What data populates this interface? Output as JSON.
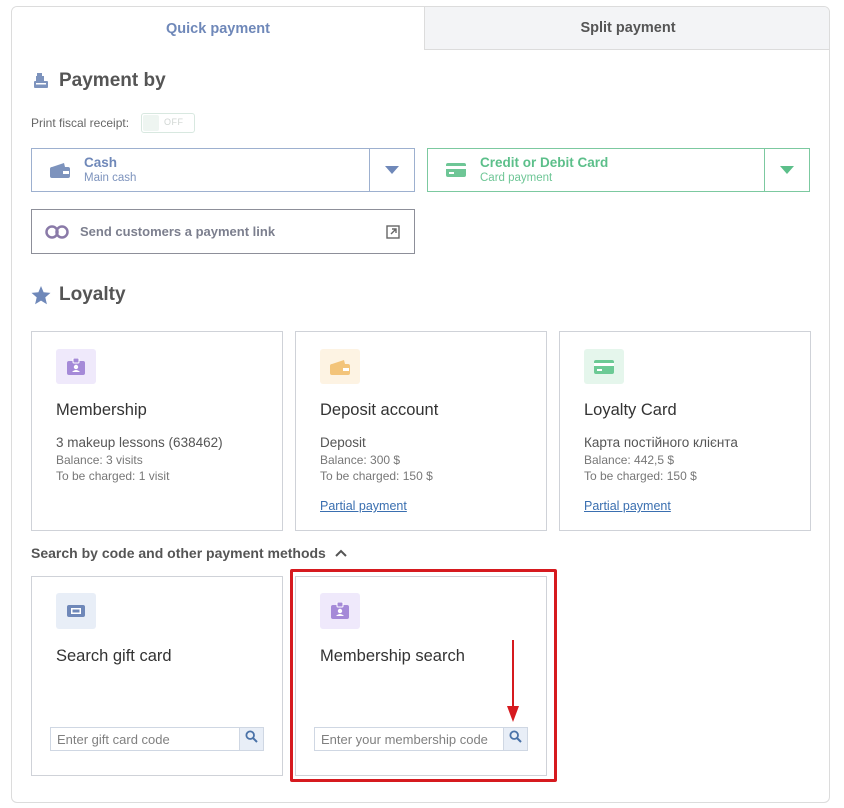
{
  "tabs": [
    {
      "label": "Quick payment",
      "active": true
    },
    {
      "label": "Split payment",
      "active": false
    }
  ],
  "payment_by": {
    "title": "Payment by",
    "fiscal_label": "Print fiscal receipt:",
    "fiscal_toggle": "OFF",
    "cash": {
      "title": "Cash",
      "subtitle": "Main cash",
      "color": "#6f88b9"
    },
    "card": {
      "title": "Credit or Debit Card",
      "subtitle": "Card payment",
      "color": "#5cbf8a"
    },
    "payment_link": "Send customers a payment link"
  },
  "loyalty": {
    "title": "Loyalty",
    "cards": [
      {
        "name": "Membership",
        "subtitle": "3 makeup lessons (638462)",
        "line1": "Balance: 3 visits",
        "line2": "To be charged: 1 visit",
        "link": "",
        "icon": "membership-badge-icon",
        "icon_bg": "#efe9fb",
        "icon_color": "#a58ad8"
      },
      {
        "name": "Deposit account",
        "subtitle": "Deposit",
        "line1": "Balance: 300 $",
        "line2": "To be charged: 150 $",
        "link": "Partial payment",
        "icon": "wallet-icon",
        "icon_bg": "#fdf3e3",
        "icon_color": "#f3c47a"
      },
      {
        "name": "Loyalty Card",
        "subtitle": "Карта постійного клієнта",
        "line1": "Balance: 442,5 $",
        "line2": "To be charged: 150 $",
        "link": "Partial payment",
        "icon": "credit-card-icon",
        "icon_bg": "#e5f6ec",
        "icon_color": "#6cca95"
      }
    ]
  },
  "search": {
    "header": "Search by code and other payment methods",
    "gift_card": {
      "name": "Search gift card",
      "placeholder": "Enter gift card code"
    },
    "membership": {
      "name": "Membership search",
      "placeholder": "Enter your membership code"
    }
  },
  "colors": {
    "highlight": "#d61a1f",
    "accent": "#6f88b9"
  }
}
